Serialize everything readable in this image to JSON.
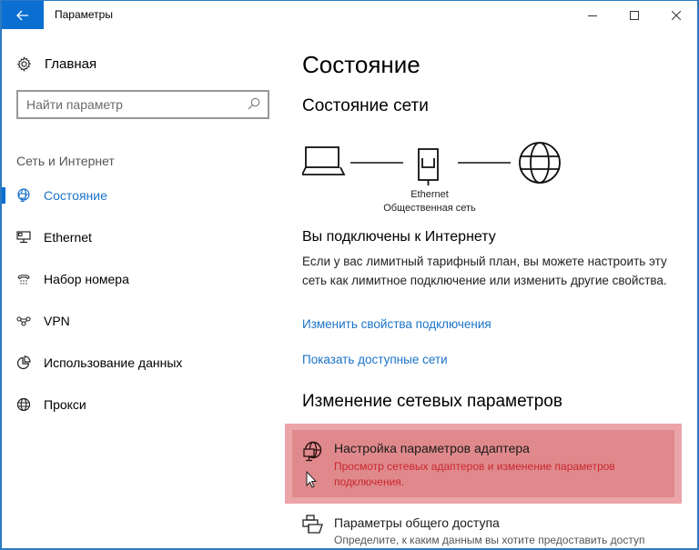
{
  "window": {
    "title": "Параметры",
    "controls": {
      "minimize": "minimize",
      "maximize": "maximize",
      "close": "close"
    }
  },
  "colors": {
    "accent": "#0a6fd1",
    "link": "#1a73c8",
    "highlight": "#e0898c",
    "highlight_text": "#c8282e"
  },
  "sidebar": {
    "home_label": "Главная",
    "search_placeholder": "Найти параметр",
    "section_label": "Сеть и Интернет",
    "items": [
      {
        "label": "Состояние",
        "icon": "network-status-icon",
        "active": true
      },
      {
        "label": "Ethernet",
        "icon": "ethernet-icon",
        "active": false
      },
      {
        "label": "Набор номера",
        "icon": "dial-up-icon",
        "active": false
      },
      {
        "label": "VPN",
        "icon": "vpn-icon",
        "active": false
      },
      {
        "label": "Использование данных",
        "icon": "data-usage-icon",
        "active": false
      },
      {
        "label": "Прокси",
        "icon": "globe-icon",
        "active": false
      }
    ]
  },
  "main": {
    "title": "Состояние",
    "network_status_heading": "Состояние сети",
    "diagram": {
      "adapter_name": "Ethernet",
      "network_type": "Общественная сеть"
    },
    "connected_heading": "Вы подключены к Интернету",
    "connected_desc": "Если у вас лимитный тарифный план, вы можете настроить эту сеть как лимитное подключение или изменить другие свойства.",
    "links": {
      "change_properties": "Изменить свойства подключения",
      "show_networks": "Показать доступные сети"
    },
    "change_settings_heading": "Изменение сетевых параметров",
    "options": [
      {
        "title": "Настройка параметров адаптера",
        "subtitle": "Просмотр сетевых адаптеров и изменение параметров подключения.",
        "highlighted": true
      },
      {
        "title": "Параметры общего доступа",
        "subtitle": "Определите, к каким данным вы хотите предоставить доступ",
        "highlighted": false
      }
    ]
  }
}
